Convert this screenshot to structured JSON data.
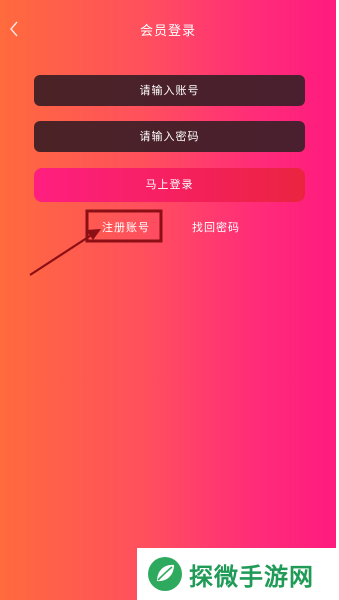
{
  "header": {
    "title": "会员登录",
    "back_icon": "chevron-left-icon"
  },
  "form": {
    "username_placeholder": "请输入账号",
    "password_placeholder": "请输入密码",
    "login_label": "马上登录",
    "register_label": "注册账号",
    "forgot_label": "找回密码"
  },
  "watermark": {
    "text": "探微手游网",
    "logo_icon": "leaf-logo-icon"
  },
  "colors": {
    "annotation": "#8b0f14",
    "watermark_green": "#1f9a57"
  }
}
